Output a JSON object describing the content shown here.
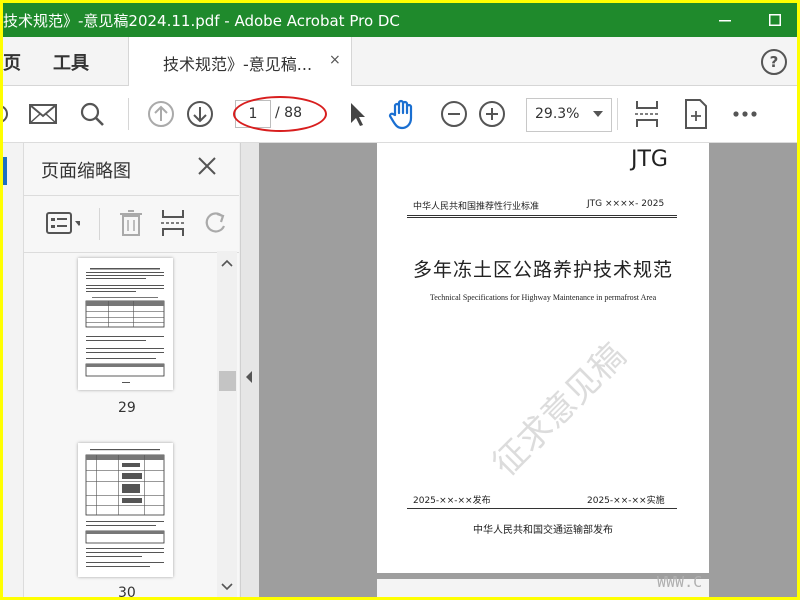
{
  "window": {
    "title": "技术规范》-意见稿2024.11.pdf - Adobe Acrobat Pro DC",
    "accent_color": "#1f8a2c",
    "frame_color": "#ffff00"
  },
  "tabs": {
    "home": "页",
    "tools": "工具",
    "document": "技术规范》-意见稿...",
    "close": "×",
    "help": "?"
  },
  "toolbar": {
    "current_page": "1",
    "total_pages": "/ 88",
    "zoom": "29.3%"
  },
  "thumbnail_panel": {
    "title": "页面缩略图",
    "thumbnails": [
      {
        "label": "29"
      },
      {
        "label": "30"
      }
    ]
  },
  "document_page": {
    "code": "JTG",
    "header_left": "中华人民共和国推荐性行业标准",
    "header_right": "JTG  ××××- 2025",
    "title": "多年冻土区公路养护技术规范",
    "subtitle": "Technical Specifications for Highway Maintenance in permafrost Area",
    "watermark": "征求意见稿",
    "issue_date": "2025-××-××发布",
    "effective_date": "2025-××-××实施",
    "issuer": "中华人民共和国交通运输部发布"
  },
  "site_watermark": "WWW.C"
}
